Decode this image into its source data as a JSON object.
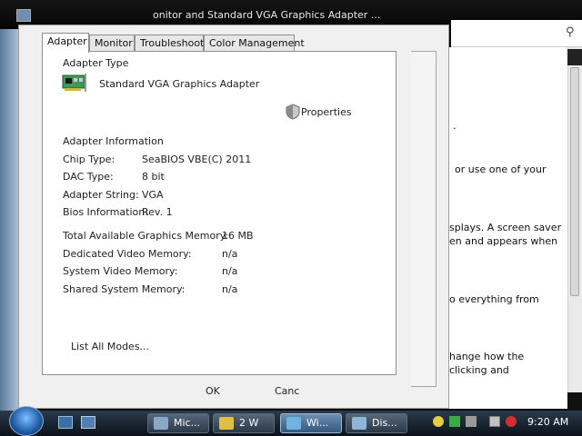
{
  "background_window": {
    "title": "onitor and Standard VGA Graphics Adapter ...",
    "text_lines": [
      ".",
      "or use one of your",
      "splays. A screen saver",
      "en and appears when",
      "o everything from",
      "hange how the",
      "clicking and"
    ]
  },
  "dialog": {
    "tabs": [
      "Adapter",
      "Monitor",
      "Troubleshoot",
      "Color Management"
    ],
    "adapter_type_heading": "Adapter Type",
    "adapter_name": "Standard VGA Graphics Adapter",
    "properties_label": "Properties",
    "adapter_info_heading": "Adapter Information",
    "info_rows": [
      {
        "label": "Chip Type:",
        "value": "SeaBIOS VBE(C) 2011"
      },
      {
        "label": "DAC Type:",
        "value": "8 bit"
      },
      {
        "label": "Adapter String:",
        "value": "VGA"
      },
      {
        "label": "Bios Information:",
        "value": "Rev. 1"
      }
    ],
    "memory_rows": [
      {
        "label": "Total Available Graphics Memory:",
        "value": "16 MB"
      },
      {
        "label": "Dedicated Video Memory:",
        "value": "n/a"
      },
      {
        "label": "System Video Memory:",
        "value": "n/a"
      },
      {
        "label": "Shared System Memory:",
        "value": "n/a"
      }
    ],
    "list_all_modes": "List All Modes...",
    "ok": "OK",
    "cancel": "Canc"
  },
  "taskbar": {
    "buttons": [
      {
        "label": "Mic...",
        "icon": "microsoft-icon"
      },
      {
        "label": "2 W",
        "icon": "folder-icon"
      },
      {
        "label": "Wi...",
        "icon": "window-icon"
      },
      {
        "label": "Dis...",
        "icon": "display-icon"
      }
    ],
    "clock": "9:20 AM"
  }
}
